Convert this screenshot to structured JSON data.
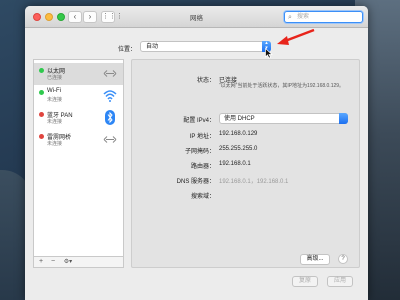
{
  "window": {
    "title": "网络"
  },
  "toolbar": {
    "back_icon": "‹",
    "forward_icon": "›",
    "grid_icon": "⋮⋮⋮",
    "search_placeholder": "搜索"
  },
  "location": {
    "label": "位置：",
    "value": "自动"
  },
  "services": [
    {
      "name": "以太网",
      "status": "已连接",
      "dot_color": "#2fc94d",
      "icon": "ethernet-icon"
    },
    {
      "name": "Wi-Fi",
      "status": "未连接",
      "dot_color": "#2fc94d",
      "icon": "wifi-icon"
    },
    {
      "name": "蓝牙 PAN",
      "status": "未连接",
      "dot_color": "#e0443e",
      "icon": "bluetooth-icon"
    },
    {
      "name": "雷雳网桥",
      "status": "未连接",
      "dot_color": "#e0443e",
      "icon": "thunderbolt-bridge-icon"
    }
  ],
  "sidebar_controls": {
    "add": "+",
    "remove": "−",
    "action": "⚙▾"
  },
  "detail": {
    "status_label": "状态：",
    "status_value": "已连接",
    "status_desc": "“以太网”当前处于活跃状态，其IP地址为192.168.0.129。",
    "configure_label": "配置 IPv4：",
    "configure_value": "使用 DHCP",
    "ip_label": "IP 地址：",
    "ip_value": "192.168.0.129",
    "subnet_label": "子网掩码：",
    "subnet_value": "255.255.255.0",
    "router_label": "路由器：",
    "router_value": "192.168.0.1",
    "dns_label": "DNS 服务器：",
    "dns_value": "192.168.0.1，192.168.0.1",
    "search_domain_label": "搜索域：",
    "advanced_button": "高级...",
    "help_button": "?"
  },
  "footer": {
    "revert_button": "复原",
    "apply_button": "应用"
  },
  "colors": {
    "accent": "#1c6ff0",
    "annotation_arrow": "#e8241b"
  }
}
